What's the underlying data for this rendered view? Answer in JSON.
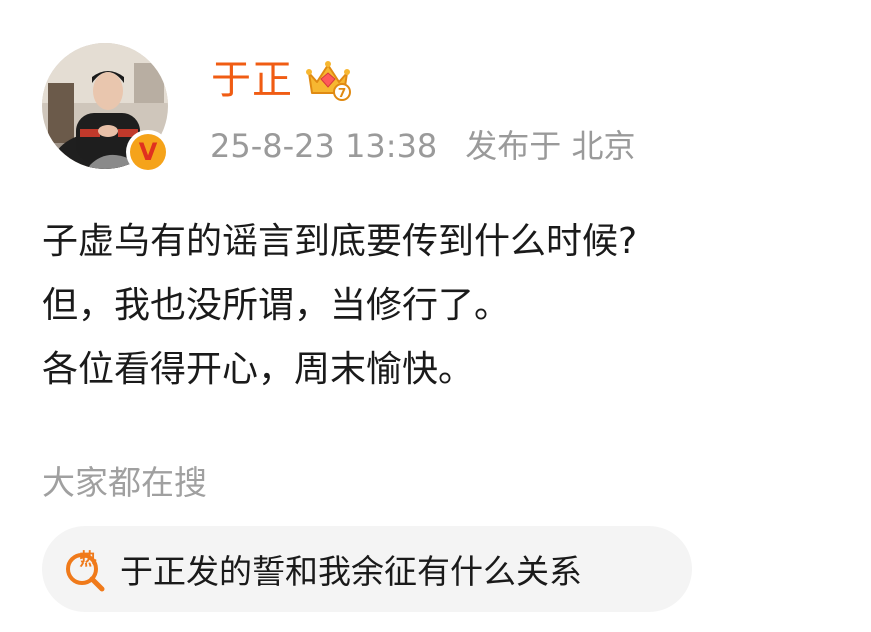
{
  "author": {
    "name": "于正",
    "verified_badge": "V",
    "avatar_icon": "avatar-photo",
    "crown_icon": "crown-icon",
    "crown_level": "7"
  },
  "meta": {
    "timestamp": "25-8-23 13:38",
    "location": "发布于 北京"
  },
  "post": {
    "lines": [
      "子虚乌有的谣言到底要传到什么时候?",
      "但，我也没所谓，当修行了。",
      "各位看得开心，周末愉快。"
    ]
  },
  "search_section": {
    "heading": "大家都在搜",
    "hot_icon_label": "热",
    "item": "于正发的誓和我余征有什么关系"
  },
  "colors": {
    "username": "#f05c13",
    "meta": "#9a9a9a",
    "badge": "#f5a31a",
    "chip_bg": "#f4f4f4",
    "hot_icon": "#f07a1a"
  }
}
